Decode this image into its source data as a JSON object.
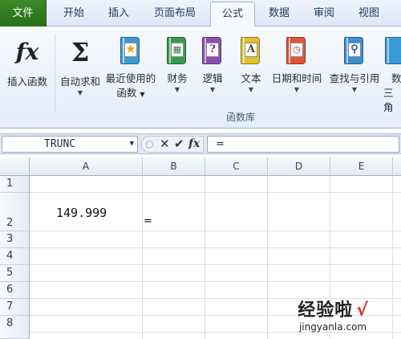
{
  "tabs": [
    "文件",
    "开始",
    "插入",
    "页面布局",
    "公式",
    "数据",
    "审阅",
    "视图"
  ],
  "active_tab": "公式",
  "ribbon": {
    "insert_function": "插入函数",
    "autosum": "自动求和",
    "recently_used_1": "最近使用的",
    "recently_used_2": "函数",
    "financial": "财务",
    "logical": "逻辑",
    "text": "文本",
    "date_time": "日期和时间",
    "lookup": "查找与引用",
    "math_1": "数",
    "math_2": "三角",
    "group_label": "函数库"
  },
  "formula_bar": {
    "name_box": "TRUNC",
    "formula": "="
  },
  "columns": [
    "A",
    "B",
    "C",
    "D",
    "E"
  ],
  "rows": [
    "1",
    "2",
    "3",
    "4",
    "5",
    "6",
    "7",
    "8"
  ],
  "cells": {
    "A2": "149.999",
    "B2": "="
  },
  "watermark": {
    "text": "经验啦",
    "check": "√",
    "url": "jingyanla.com"
  },
  "colors": {
    "file_tab": "#2f7d22",
    "ribbon_bg": "#e4edf8",
    "grid_line": "#d8dee6"
  }
}
